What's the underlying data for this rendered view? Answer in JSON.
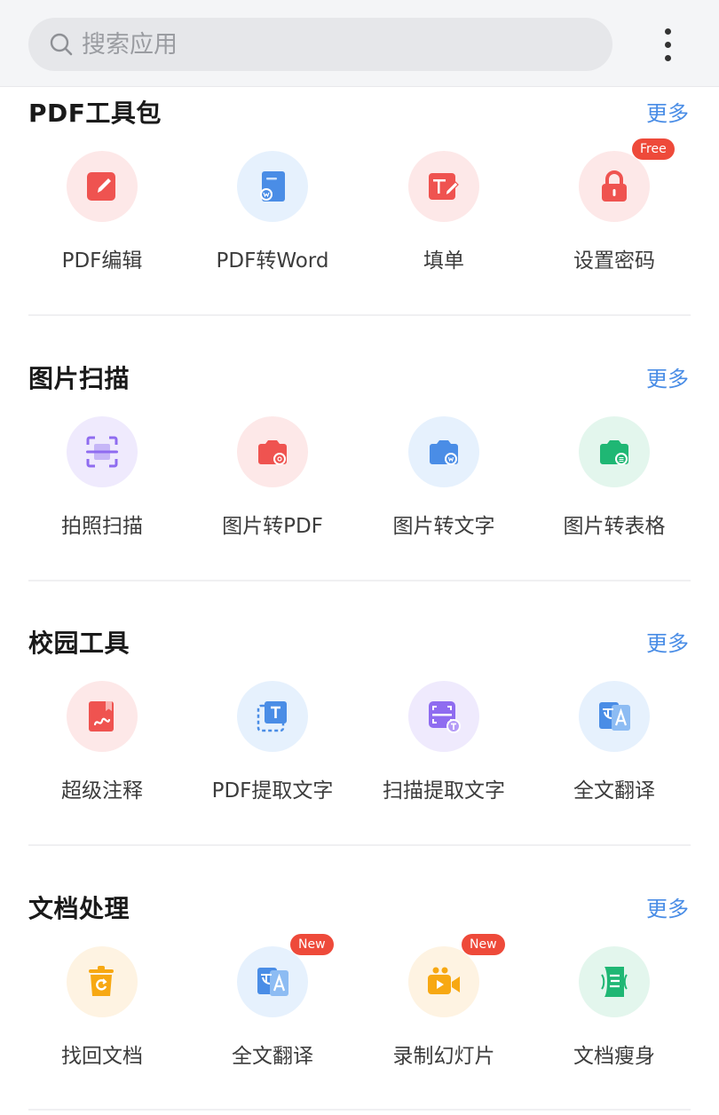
{
  "search": {
    "placeholder": "搜索应用"
  },
  "sections": [
    {
      "title": "PDF工具包",
      "more": "更多",
      "items": [
        {
          "label": "PDF编辑",
          "icon": "pdf-edit-icon",
          "badge": ""
        },
        {
          "label": "PDF转Word",
          "icon": "pdf-to-word-icon",
          "badge": ""
        },
        {
          "label": "填单",
          "icon": "fill-form-icon",
          "badge": ""
        },
        {
          "label": "设置密码",
          "icon": "lock-icon",
          "badge": "Free"
        }
      ]
    },
    {
      "title": "图片扫描",
      "more": "更多",
      "items": [
        {
          "label": "拍照扫描",
          "icon": "scan-icon",
          "badge": ""
        },
        {
          "label": "图片转PDF",
          "icon": "camera-pdf-icon",
          "badge": ""
        },
        {
          "label": "图片转文字",
          "icon": "camera-text-icon",
          "badge": ""
        },
        {
          "label": "图片转表格",
          "icon": "camera-table-icon",
          "badge": ""
        }
      ]
    },
    {
      "title": "校园工具",
      "more": "更多",
      "items": [
        {
          "label": "超级注释",
          "icon": "annotate-icon",
          "badge": ""
        },
        {
          "label": "PDF提取文字",
          "icon": "pdf-extract-text-icon",
          "badge": ""
        },
        {
          "label": "扫描提取文字",
          "icon": "scan-extract-text-icon",
          "badge": ""
        },
        {
          "label": "全文翻译",
          "icon": "translate-icon",
          "badge": ""
        }
      ]
    },
    {
      "title": "文档处理",
      "more": "更多",
      "items": [
        {
          "label": "找回文档",
          "icon": "recover-document-icon",
          "badge": ""
        },
        {
          "label": "全文翻译",
          "icon": "translate-icon",
          "badge": "New"
        },
        {
          "label": "录制幻灯片",
          "icon": "record-video-icon",
          "badge": "New"
        },
        {
          "label": "文档瘦身",
          "icon": "compress-document-icon",
          "badge": ""
        }
      ]
    }
  ],
  "colors": {
    "red": "#ef5350",
    "red_bg": "#fde8e8",
    "blue": "#4a8de6",
    "blue_bg": "#e6f1fd",
    "purple": "#8f6cf0",
    "purple_bg": "#efeafd",
    "green": "#1fb774",
    "green_bg": "#e3f6ed",
    "orange": "#f7a813",
    "orange_bg": "#fef3e2"
  }
}
